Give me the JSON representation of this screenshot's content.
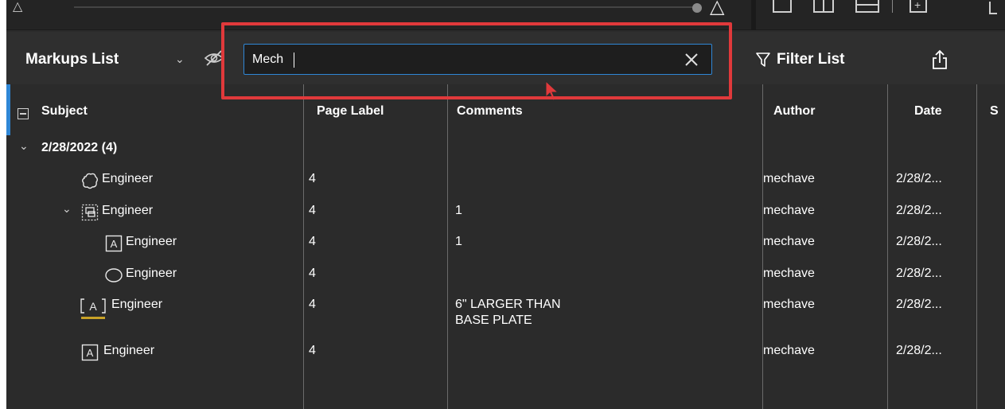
{
  "panel": {
    "title": "Markups List",
    "search_value": "Mech",
    "filter_label": "Filter List"
  },
  "columns": {
    "subject": "Subject",
    "page_label": "Page Label",
    "comments": "Comments",
    "author": "Author",
    "date": "Date",
    "status_partial": "S"
  },
  "group": {
    "label": "2/28/2022 (4)"
  },
  "rows": [
    {
      "icon": "cloud-icon",
      "subject": "Engineer",
      "page_label": "4",
      "comments": "",
      "author": "mechave",
      "date": "2/28/2..."
    },
    {
      "icon": "group-icon",
      "subject": "Engineer",
      "page_label": "4",
      "comments": "1",
      "author": "mechave",
      "date": "2/28/2..."
    },
    {
      "icon": "text-box-icon",
      "subject": "Engineer",
      "page_label": "4",
      "comments": "1",
      "author": "mechave",
      "date": "2/28/2..."
    },
    {
      "icon": "ellipse-icon",
      "subject": "Engineer",
      "page_label": "4",
      "comments": "",
      "author": "mechave",
      "date": "2/28/2..."
    },
    {
      "icon": "highlight-text-icon",
      "subject": "Engineer",
      "page_label": "4",
      "comments_line1": "6\" LARGER THAN",
      "comments_line2": "BASE PLATE",
      "author": "mechave",
      "date": "2/28/2..."
    },
    {
      "icon": "text-box-icon",
      "subject": "Engineer",
      "page_label": "4",
      "comments": "",
      "author": "mechave",
      "date": "2/28/2..."
    }
  ],
  "colors": {
    "annotation": "#e0393b",
    "focus": "#2f87d6",
    "highlight_underline": "#c9a227"
  }
}
